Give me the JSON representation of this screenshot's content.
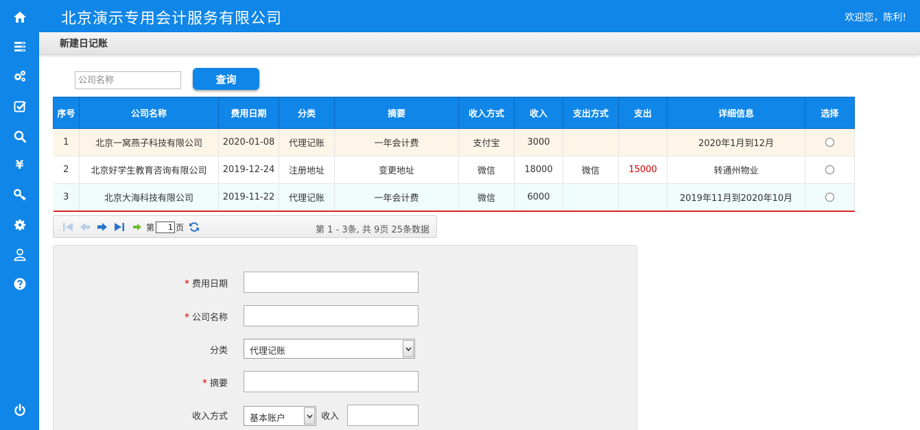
{
  "header": {
    "company": "北京演示专用会计服务有限公司",
    "welcome": "欢迎您，陈利!"
  },
  "page": {
    "title": "新建日记账"
  },
  "search": {
    "placeholder": "公司名称",
    "button": "查询"
  },
  "table": {
    "headers": [
      "序号",
      "公司名称",
      "费用日期",
      "分类",
      "摘要",
      "收入方式",
      "收入",
      "支出方式",
      "支出",
      "详细信息",
      "选择"
    ],
    "rows": [
      [
        "1",
        "北京一窝燕子科技有限公司",
        "2020-01-08",
        "代理记账",
        "一年会计费",
        "支付宝",
        "3000",
        "",
        "",
        "2020年1月到12月"
      ],
      [
        "2",
        "北京好学生教育咨询有限公司",
        "2019-12-24",
        "注册地址",
        "变更地址",
        "微信",
        "18000",
        "微信",
        "15000",
        "转通州物业"
      ],
      [
        "3",
        "北京大海科技有限公司",
        "2019-11-22",
        "代理记账",
        "一年会计费",
        "微信",
        "6000",
        "",
        "",
        "2019年11月到2020年10月"
      ]
    ]
  },
  "pager": {
    "page_prefix": "第",
    "page_value": "1",
    "page_suffix": "页",
    "info": "第 1 - 3条, 共 9页 25条数据"
  },
  "form": {
    "required_mark": "*",
    "date_label": "费用日期",
    "company_label": "公司名称",
    "category_label": "分类",
    "category_value": "代理记账",
    "summary_label": "摘要",
    "income_method_label": "收入方式",
    "income_method_value": "基本账户",
    "income_label": "收入"
  },
  "colors": {
    "primary": "#0f86e8",
    "expense": "#d40000"
  }
}
